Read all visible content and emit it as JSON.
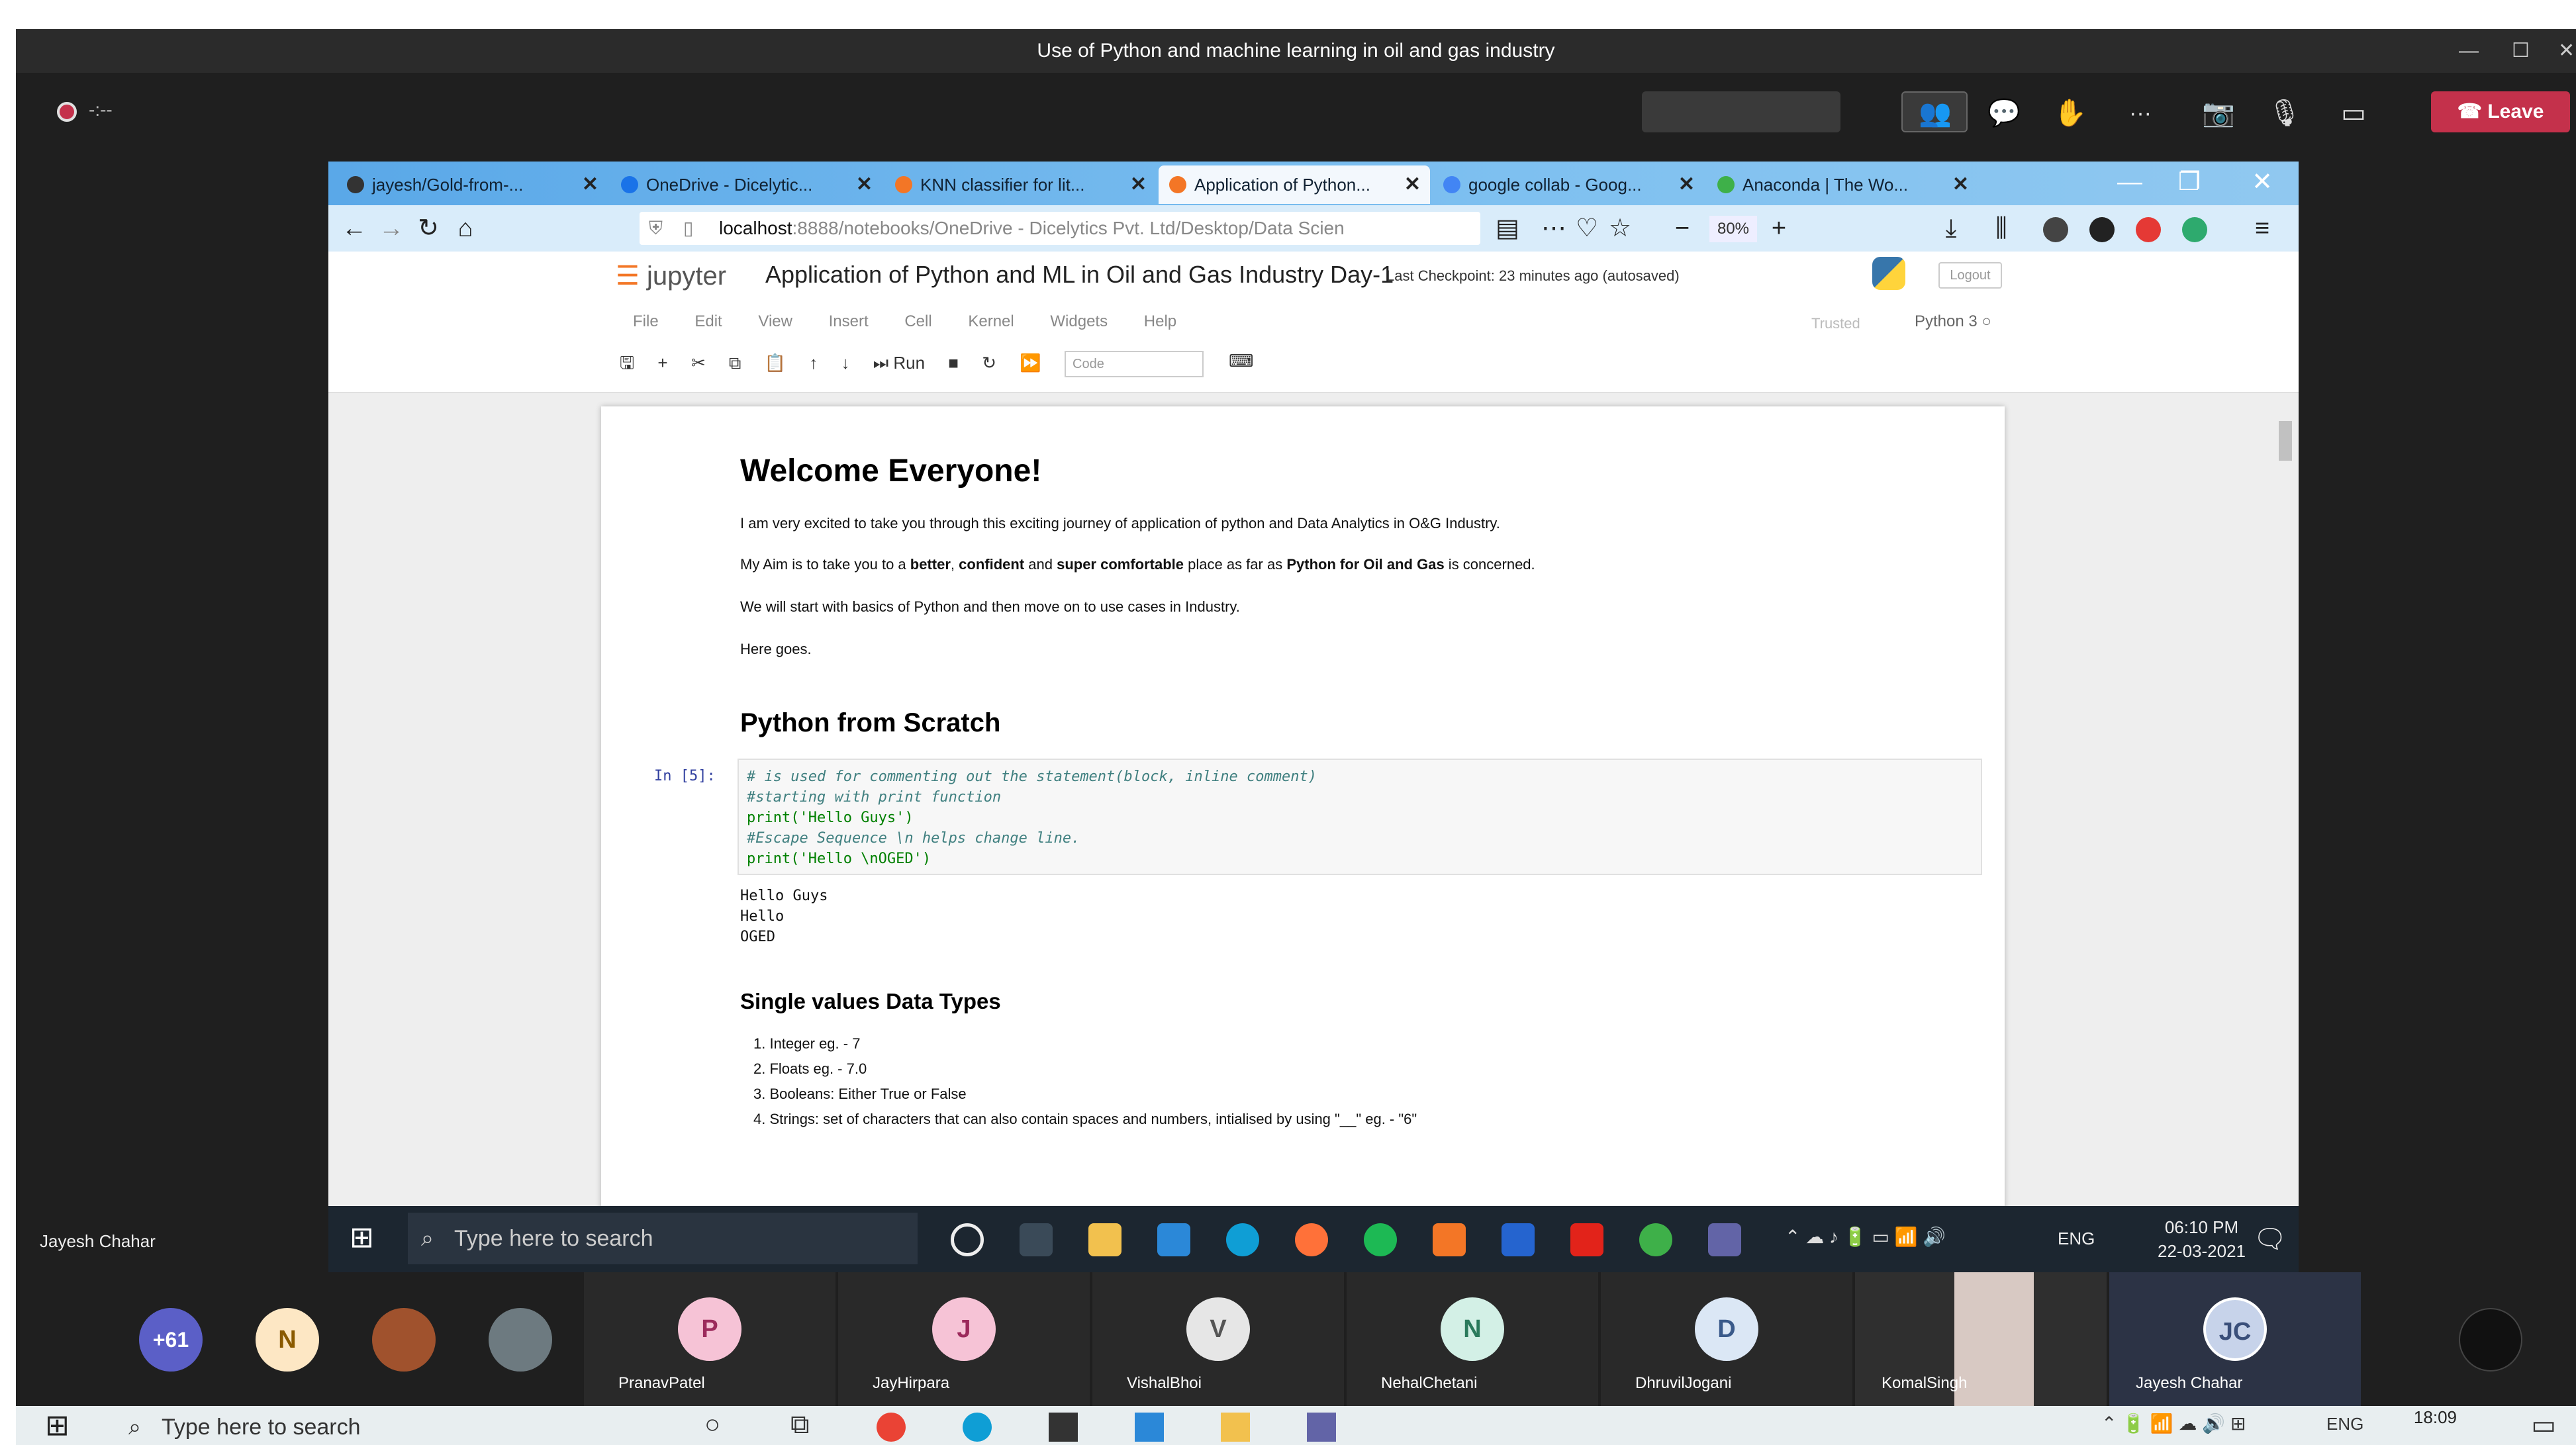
{
  "teams": {
    "window_title": "Use of Python and machine learning in oil and gas industry",
    "record_time": "-:--",
    "leave_label": "Leave",
    "people_icon": "people-icon",
    "chat_icon": "chat-icon",
    "hand_icon": "raise-hand-icon",
    "more_label": "···"
  },
  "browser": {
    "tabs": [
      {
        "label": "jayesh/Gold-from-..."
      },
      {
        "label": "OneDrive - Dicelytic..."
      },
      {
        "label": "KNN classifier for lit..."
      },
      {
        "label": "Application of Python..."
      },
      {
        "label": "google collab - Goog..."
      },
      {
        "label": "Anaconda | The Wo..."
      }
    ],
    "url_host": "localhost",
    "url_rest": ":8888/notebooks/OneDrive - Dicelytics Pvt. Ltd/Desktop/Data Scien",
    "zoom": "80%"
  },
  "jupyter": {
    "logo_text": "jupyter",
    "notebook_title": "Application of Python and ML in Oil and Gas Industry Day-1",
    "checkpoint": "Last Checkpoint: 23 minutes ago  (autosaved)",
    "logout": "Logout",
    "menu": [
      "File",
      "Edit",
      "View",
      "Insert",
      "Cell",
      "Kernel",
      "Widgets",
      "Help"
    ],
    "trusted": "Trusted",
    "kernel": "Python 3",
    "run_label": "Run",
    "cell_type": "Code"
  },
  "notebook": {
    "h1": "Welcome Everyone!",
    "p1": "I am very excited to take you through this exciting journey of application of python and Data Analytics in O&G Industry.",
    "p2_parts": [
      "My Aim is to take you to a ",
      "better",
      ", ",
      "confident",
      " and ",
      "super comfortable",
      " place as far as ",
      "Python for Oil and Gas",
      " is concerned."
    ],
    "p3": "We will start with basics of Python and then move on to use cases in Industry.",
    "p4": "Here goes.",
    "h2": "Python from Scratch",
    "prompt": "In [5]:",
    "code_lines": [
      "# is used for commenting out the statement(block, inline comment)",
      "#starting with print function",
      "print('Hello Guys')",
      "#Escape Sequence \\n helps change line.",
      "print('Hello \\nOGED')"
    ],
    "output_lines": [
      "Hello Guys",
      "Hello",
      "OGED"
    ],
    "h3": "Single values Data Types",
    "list": [
      "1. Integer eg. - 7",
      "2. Floats eg. - 7.0",
      "3. Booleans: Either True or False",
      "4. Strings: set of characters that can also contain spaces and numbers, intialised by using \"__\" eg. - \"6\""
    ]
  },
  "inner_taskbar": {
    "search_placeholder": "Type here to search",
    "lang": "ENG",
    "time": "06:10 PM",
    "date": "22-03-2021"
  },
  "presenter": "Jayesh Chahar",
  "participants": {
    "overflow": "+61",
    "tiles": [
      {
        "initial": "N",
        "name": ""
      },
      {
        "initial": "P",
        "name": "PranavPatel"
      },
      {
        "initial": "J",
        "name": "JayHirpara"
      },
      {
        "initial": "V",
        "name": "VishalBhoi"
      },
      {
        "initial": "N",
        "name": "NehalChetani"
      },
      {
        "initial": "D",
        "name": "DhruvilJogani"
      },
      {
        "initial": "",
        "name": "KomalSingh"
      },
      {
        "initial": "JC",
        "name": "Jayesh Chahar"
      }
    ]
  },
  "outer_taskbar": {
    "search_placeholder": "Type here to search",
    "lang": "ENG",
    "time": "18:09"
  }
}
